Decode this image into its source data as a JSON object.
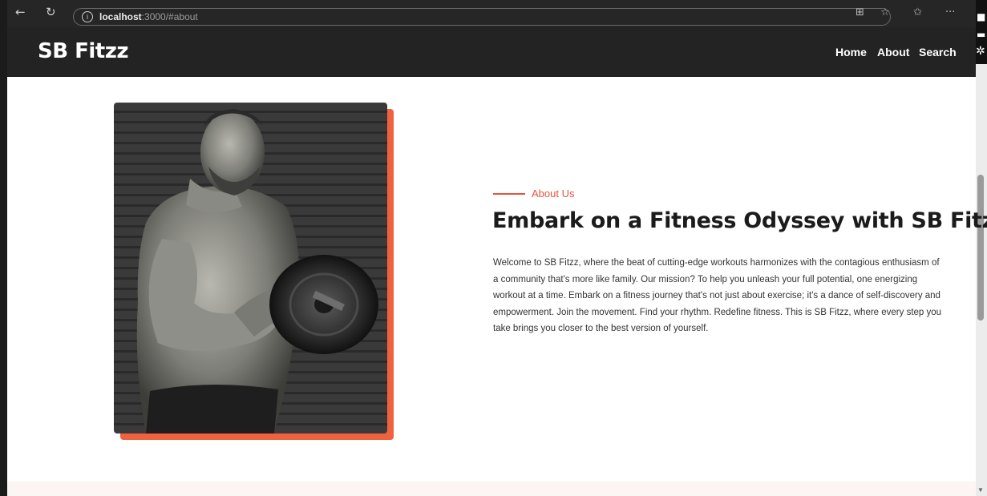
{
  "browser": {
    "back_icon": "back-arrow-icon",
    "reload_icon": "reload-icon",
    "url_host": "localhost",
    "url_path": ":3000/#about",
    "right_icons": [
      "apps-icon",
      "star-icon",
      "favorites-icon",
      "more-icon"
    ]
  },
  "site": {
    "logo": "SB Fitzz",
    "nav": [
      "Home",
      "About",
      "Search"
    ]
  },
  "about": {
    "eyebrow": "About Us",
    "heading": "Embark on a Fitness Odyssey with SB Fitzz..",
    "paragraph": "Welcome to SB Fitzz, where the beat of cutting-edge workouts harmonizes with the contagious enthusiasm of a community that's more like family. Our mission? To help you unleash your full potential, one energizing workout at a time. Embark on a fitness journey that's not just about exercise; it's a dance of self-discovery and empowerment. Join the movement. Find your rhythm. Redefine fitness. This is SB Fitzz, where every step you take brings you closer to the best version of yourself."
  },
  "colors": {
    "accent": "#e8533b",
    "image_shadow": "#f0623f",
    "header_bg": "#232323"
  }
}
